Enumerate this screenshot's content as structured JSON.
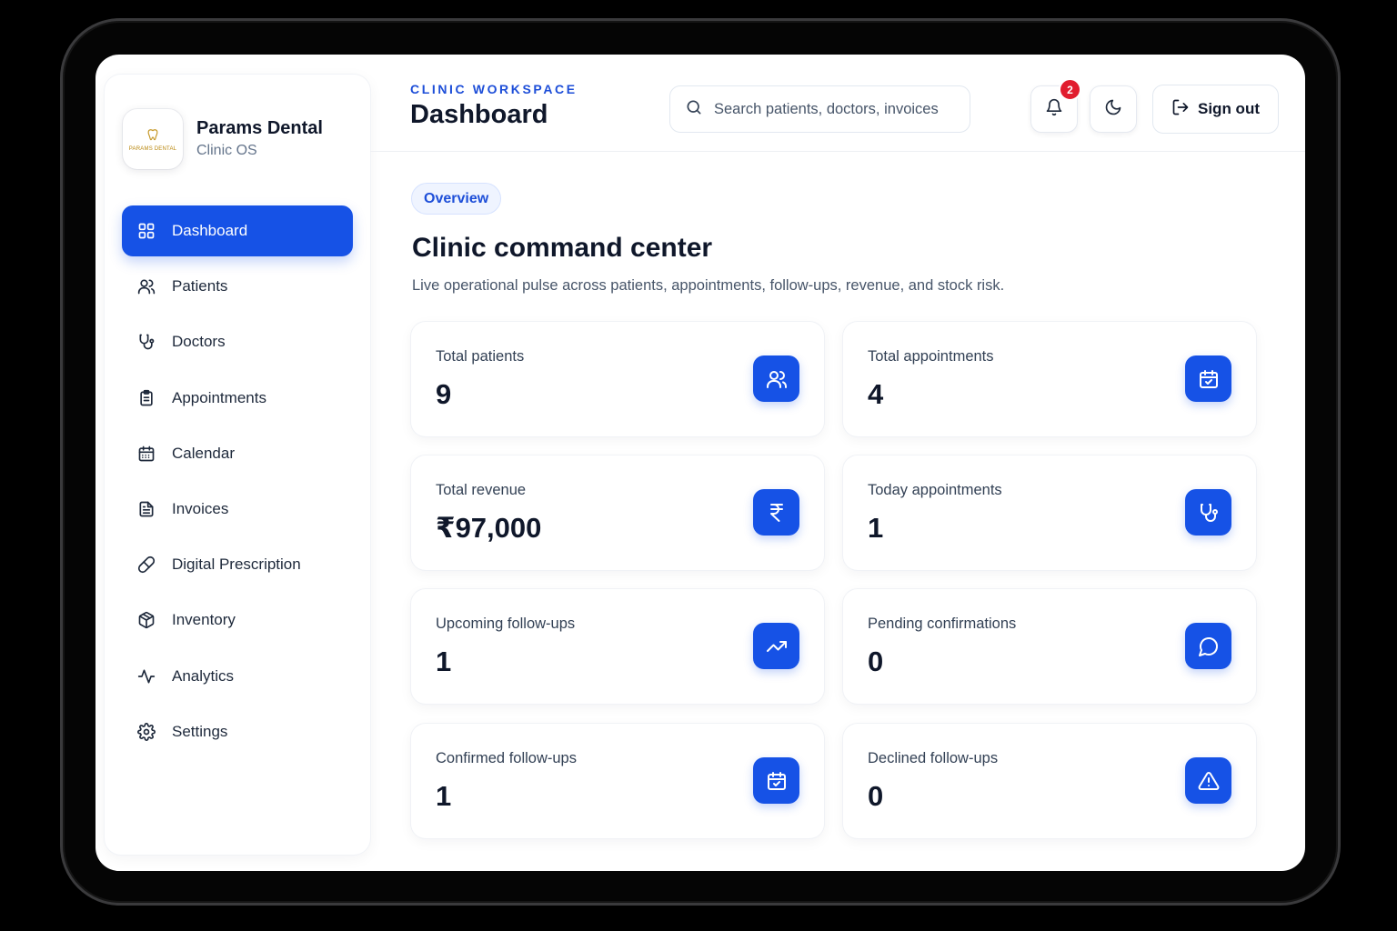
{
  "brand": {
    "name": "Params Dental",
    "subtitle": "Clinic OS",
    "logo_text": "PARAMS DENTAL"
  },
  "sidebar": {
    "items": [
      {
        "label": "Dashboard",
        "icon": "grid-icon",
        "active": true
      },
      {
        "label": "Patients",
        "icon": "users-icon"
      },
      {
        "label": "Doctors",
        "icon": "stethoscope-icon"
      },
      {
        "label": "Appointments",
        "icon": "clipboard-icon"
      },
      {
        "label": "Calendar",
        "icon": "calendar-icon"
      },
      {
        "label": "Invoices",
        "icon": "file-text-icon"
      },
      {
        "label": "Digital Prescription",
        "icon": "pill-icon"
      },
      {
        "label": "Inventory",
        "icon": "box-icon"
      },
      {
        "label": "Analytics",
        "icon": "activity-icon"
      },
      {
        "label": "Settings",
        "icon": "gear-icon"
      }
    ]
  },
  "header": {
    "eyebrow": "CLINIC WORKSPACE",
    "title": "Dashboard",
    "search_placeholder": "Search patients, doctors, invoices",
    "notification_count": "2",
    "signout_label": "Sign out"
  },
  "main": {
    "pill": "Overview",
    "title": "Clinic command center",
    "description": "Live operational pulse across patients, appointments, follow-ups, revenue, and stock risk.",
    "cards": [
      {
        "label": "Total patients",
        "value": "9",
        "icon": "users-icon"
      },
      {
        "label": "Total appointments",
        "value": "4",
        "icon": "calendar-check-icon"
      },
      {
        "label": "Total revenue",
        "value": "₹97,000",
        "icon": "rupee-icon"
      },
      {
        "label": "Today appointments",
        "value": "1",
        "icon": "stethoscope-icon"
      },
      {
        "label": "Upcoming follow-ups",
        "value": "1",
        "icon": "trending-up-icon"
      },
      {
        "label": "Pending confirmations",
        "value": "0",
        "icon": "message-circle-icon"
      },
      {
        "label": "Confirmed follow-ups",
        "value": "1",
        "icon": "calendar-check-icon"
      },
      {
        "label": "Declined follow-ups",
        "value": "0",
        "icon": "alert-triangle-icon"
      }
    ]
  },
  "colors": {
    "accent": "#1652e6",
    "badge": "#e11d2e",
    "eyebrow": "#1d4ed8"
  }
}
